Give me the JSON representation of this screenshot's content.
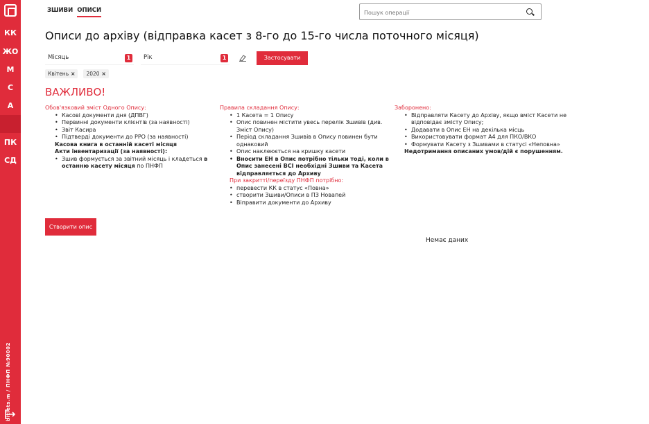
{
  "sidebar": {
    "logo_icon": "brand-logo-icon",
    "items": [
      "КК",
      "ЖО",
      "М",
      "С",
      "А",
      "ПК",
      "СД"
    ],
    "footer_text": "bitlets.m / ПНФП №90002",
    "logout_icon": "logout-icon"
  },
  "tabs": [
    "ЗШИВИ",
    "ОПИСИ"
  ],
  "search": {
    "placeholder": "Пошук операції",
    "icon": "search-icon"
  },
  "page": {
    "title": "Описи до архіву (відправка касет з 8-го до 15-го числа поточного місяця)"
  },
  "filters": {
    "month": {
      "label": "Місяць",
      "count": "1"
    },
    "year": {
      "label": "Рік",
      "count": "1"
    },
    "clear_icon": "eraser-icon",
    "apply_label": "Застосувати",
    "chips": [
      "Квітень",
      "2020"
    ]
  },
  "important": {
    "title": "ВАЖЛИВО!",
    "col1": {
      "head": "Обов'язковий зміст Одного Опису:",
      "items": [
        "Касові документи дня (ДПВГ)",
        "Первинні документи клієнтів (за наявності)",
        "Звіт Касира",
        "Підтверді документи до РРО (за наявності)"
      ],
      "sub1": "Касова книга в останній касеті місяця",
      "sub2": "Акти інвентаризації (за наявності):",
      "item_last_pre": "Зшив формується за звітний місяць і кладеться ",
      "item_last_bold": "в останню касету місяця",
      "item_last_post": " по ПНФП"
    },
    "col2": {
      "head": "Правила складання Опису:",
      "items": [
        "1 Касета = 1 Опису",
        "Опис повинен містити увесь перелік Зшивів (див. Зміст Опису)",
        "Період складання Зшивів в Опису повинен бути однаковий",
        "Опис наклеюється на кришку касети"
      ],
      "bold_item": "Вносити ЕН в Опис потрібно тільки тоді, коли в Опис занесені ВСІ необхідні Зшиви та Касета відправляється до Архиву",
      "head2": "При закритті/переїзду ПНФП потрібно:",
      "items2": [
        "перевести КК в статус «Повна»",
        "створити Зшиви/Описи в ПЗ Новапей",
        "Віправити документи до Архиву"
      ]
    },
    "col3": {
      "head": "Заборонено:",
      "items": [
        "Відправляти Касету до Архіву, якщо вміст Касети не відповідає змісту Опису;",
        "Додавати в Опис ЕН на декілька місць",
        "Використовувати формат А4 для ПКО/ВКО",
        "Формувати Касету з Зшивами в статусі «Неповна»"
      ],
      "footer": "Недотримання описаних умов/дій є порушенням."
    }
  },
  "create_label": "Створити опис",
  "no_data": "Немає даних",
  "colors": {
    "accent": "#e02c3b"
  }
}
